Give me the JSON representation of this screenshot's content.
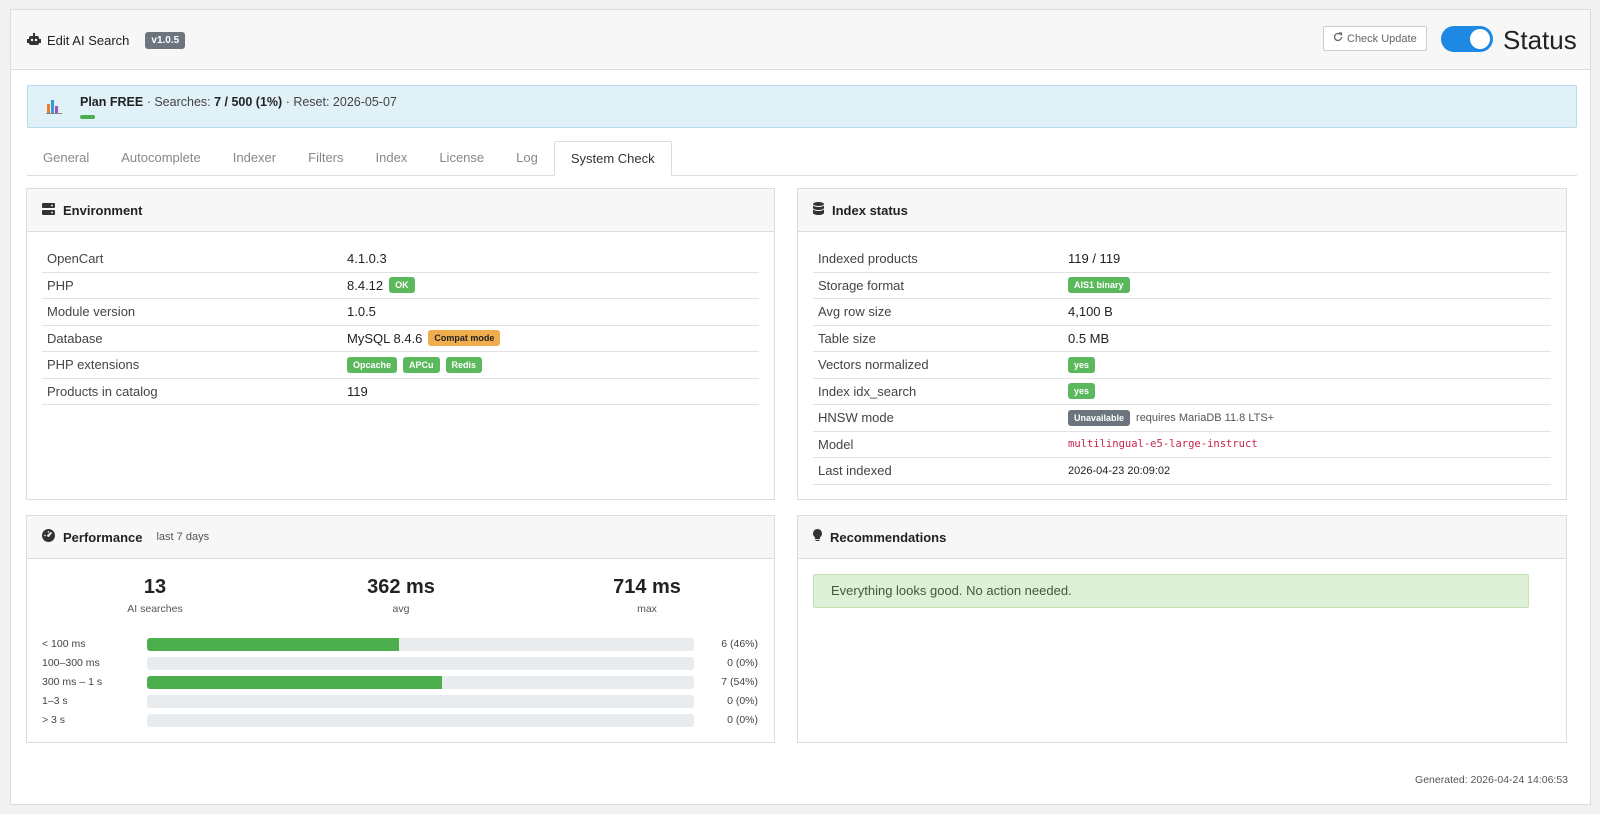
{
  "header": {
    "title": "Edit AI Search",
    "version": "v1.0.5",
    "check_update": "Check Update",
    "status_label": "Status",
    "status_on": true
  },
  "plan": {
    "plan_label": "Plan FREE",
    "searches_prefix": "Searches:",
    "searches_value": "7 / 500 (1%)",
    "reset": "Reset: 2026-05-07",
    "usage_percent": 1
  },
  "tabs": [
    "General",
    "Autocomplete",
    "Indexer",
    "Filters",
    "Index",
    "License",
    "Log",
    "System Check"
  ],
  "active_tab": "System Check",
  "environment": {
    "title": "Environment",
    "rows": [
      {
        "key": "OpenCart",
        "value": "4.1.0.3"
      },
      {
        "key": "PHP",
        "value": "8.4.12",
        "badge": "OK"
      },
      {
        "key": "Module version",
        "value": "1.0.5"
      },
      {
        "key": "Database",
        "value": "MySQL 8.4.6",
        "badge": "Compat mode"
      },
      {
        "key": "PHP extensions",
        "badges": [
          "Opcache",
          "APCu",
          "Redis"
        ]
      },
      {
        "key": "Products in catalog",
        "value": "119"
      }
    ]
  },
  "index_status": {
    "title": "Index status",
    "rows": [
      {
        "key": "Indexed products",
        "value": "119 / 119"
      },
      {
        "key": "Storage format",
        "badge": "AIS1 binary"
      },
      {
        "key": "Avg row size",
        "value": "4,100 B"
      },
      {
        "key": "Table size",
        "value": "0.5 MB"
      },
      {
        "key": "Vectors normalized",
        "badge": "yes"
      },
      {
        "key": "Index idx_search",
        "badge": "yes"
      },
      {
        "key": "HNSW mode",
        "badge": "Unavailable",
        "note": "requires MariaDB 11.8 LTS+"
      },
      {
        "key": "Model",
        "code": "multilingual-e5-large-instruct"
      },
      {
        "key": "Last indexed",
        "value": "2026-04-23 20:09:02"
      }
    ]
  },
  "performance": {
    "title": "Performance",
    "subtitle": "last 7 days",
    "stats": [
      {
        "value": "13",
        "label": "AI searches"
      },
      {
        "value": "362 ms",
        "label": "avg"
      },
      {
        "value": "714 ms",
        "label": "max"
      }
    ],
    "histogram": [
      {
        "label": "< 100 ms",
        "value": "6 (46%)",
        "percent": 46
      },
      {
        "label": "100–300 ms",
        "value": "0 (0%)",
        "percent": 0
      },
      {
        "label": "300 ms – 1 s",
        "value": "7 (54%)",
        "percent": 54
      },
      {
        "label": "1–3 s",
        "value": "0 (0%)",
        "percent": 0
      },
      {
        "label": "> 3 s",
        "value": "0 (0%)",
        "percent": 0
      }
    ]
  },
  "recommendations": {
    "title": "Recommendations",
    "message": "Everything looks good. No action needed."
  },
  "footer": {
    "generated": "Generated: 2026-04-24 14:06:53"
  }
}
